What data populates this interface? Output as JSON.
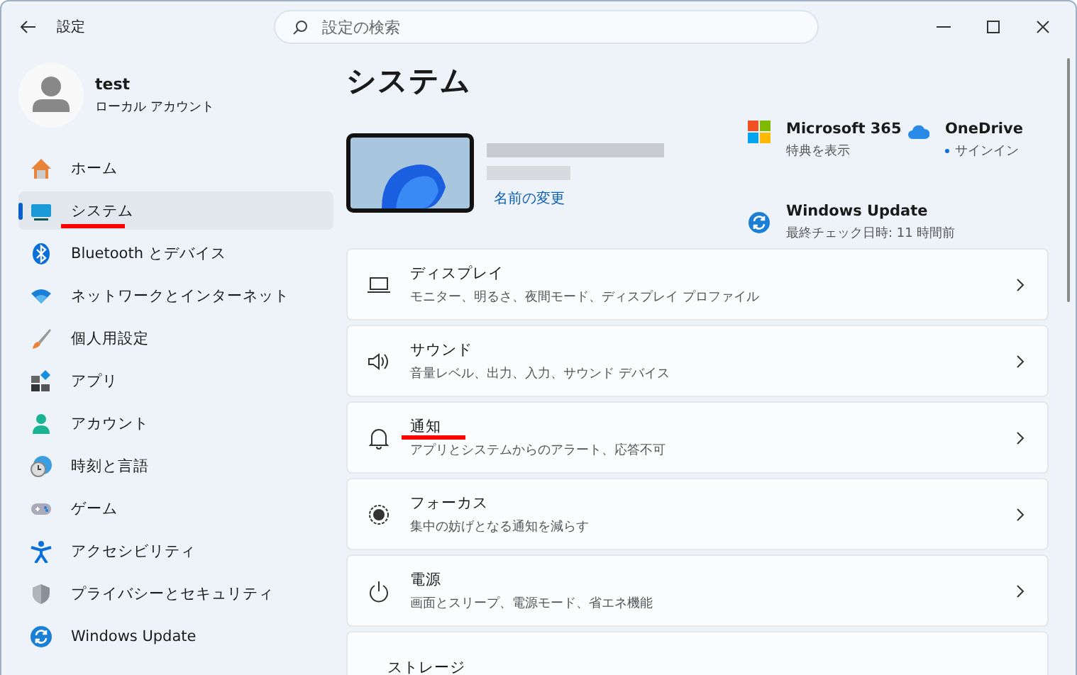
{
  "window": {
    "title": "設定"
  },
  "search": {
    "placeholder": "設定の検索"
  },
  "user": {
    "name": "test",
    "account_type": "ローカル アカウント"
  },
  "sidebar": {
    "items": [
      {
        "label": "ホーム",
        "selected": false,
        "underlined": false
      },
      {
        "label": "システム",
        "selected": true,
        "underlined": true
      },
      {
        "label": "Bluetooth とデバイス",
        "selected": false,
        "underlined": false
      },
      {
        "label": "ネットワークとインターネット",
        "selected": false,
        "underlined": false
      },
      {
        "label": "個人用設定",
        "selected": false,
        "underlined": false
      },
      {
        "label": "アプリ",
        "selected": false,
        "underlined": false
      },
      {
        "label": "アカウント",
        "selected": false,
        "underlined": false
      },
      {
        "label": "時刻と言語",
        "selected": false,
        "underlined": false
      },
      {
        "label": "ゲーム",
        "selected": false,
        "underlined": false
      },
      {
        "label": "アクセシビリティ",
        "selected": false,
        "underlined": false
      },
      {
        "label": "プライバシーとセキュリティ",
        "selected": false,
        "underlined": false
      },
      {
        "label": "Windows Update",
        "selected": false,
        "underlined": false
      }
    ]
  },
  "page_title": "システム",
  "device": {
    "rename_link": "名前の変更"
  },
  "quick_links": [
    {
      "title": "Microsoft 365",
      "subtitle": "特典を表示"
    },
    {
      "title": "OneDrive",
      "subtitle": "サインイン"
    },
    {
      "title": "Windows Update",
      "subtitle": "最終チェック日時: 11 時間前"
    }
  ],
  "settings": [
    {
      "title": "ディスプレイ",
      "description": "モニター、明るさ、夜間モード、ディスプレイ プロファイル",
      "underlined": false
    },
    {
      "title": "サウンド",
      "description": "音量レベル、出力、入力、サウンド デバイス",
      "underlined": false
    },
    {
      "title": "通知",
      "description": "アプリとシステムからのアラート、応答不可",
      "underlined": true
    },
    {
      "title": "フォーカス",
      "description": "集中の妨げとなる通知を減らす",
      "underlined": false
    },
    {
      "title": "電源",
      "description": "画面とスリープ、電源モード、省エネ機能",
      "underlined": false
    },
    {
      "title": "ストレージ"
    }
  ]
}
